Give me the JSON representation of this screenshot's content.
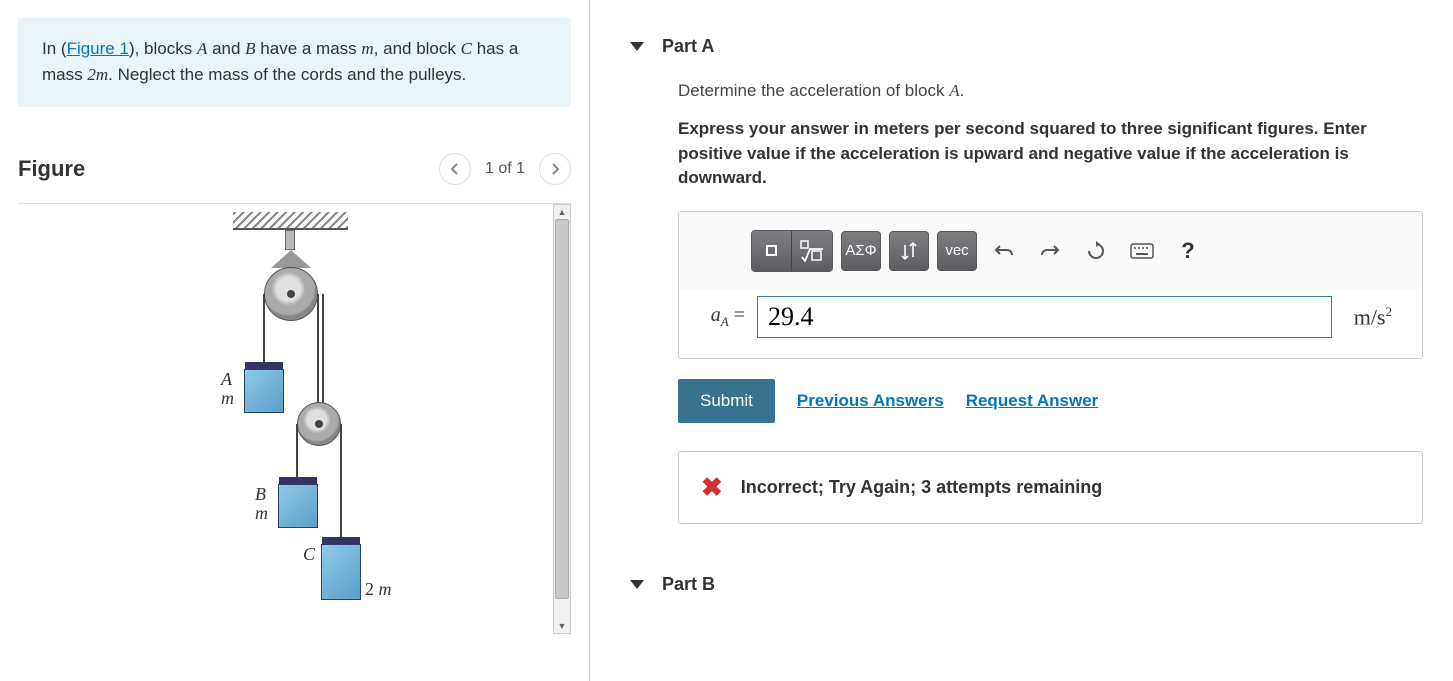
{
  "problem": {
    "prefix": "In (",
    "figure_link": "Figure 1",
    "body1": "), blocks ",
    "A": "A",
    "and": " and ",
    "B": "B",
    "body2": " have a mass ",
    "m": "m",
    "body3": ", and block ",
    "C": "C",
    "body4": " has a mass ",
    "twom": "2m",
    "tail": ". Neglect the mass of the cords and the pulleys."
  },
  "figure": {
    "title": "Figure",
    "nav_label": "1 of 1",
    "labels": {
      "A": "A",
      "massA": "m",
      "B": "B",
      "massB": "m",
      "C": "C",
      "massC": "2 m"
    }
  },
  "partA": {
    "title": "Part A",
    "instruction_prefix": "Determine the acceleration of block ",
    "instruction_var": "A",
    "instruction_suffix": ".",
    "hint": "Express your answer in meters per second squared to three significant figures. Enter positive value if the acceleration is upward and negative value if the acceleration is downward.",
    "toolbar": {
      "greek": "ΑΣΦ",
      "vec": "vec",
      "help": "?"
    },
    "var_label": "a",
    "var_sub": "A",
    "equals": " = ",
    "value": "29.4",
    "unit_html": "m/s",
    "unit_exp": "2",
    "submit": "Submit",
    "prev_answers": "Previous Answers",
    "request_answer": "Request Answer",
    "feedback": "Incorrect; Try Again; 3 attempts remaining"
  },
  "partB": {
    "title": "Part B"
  }
}
